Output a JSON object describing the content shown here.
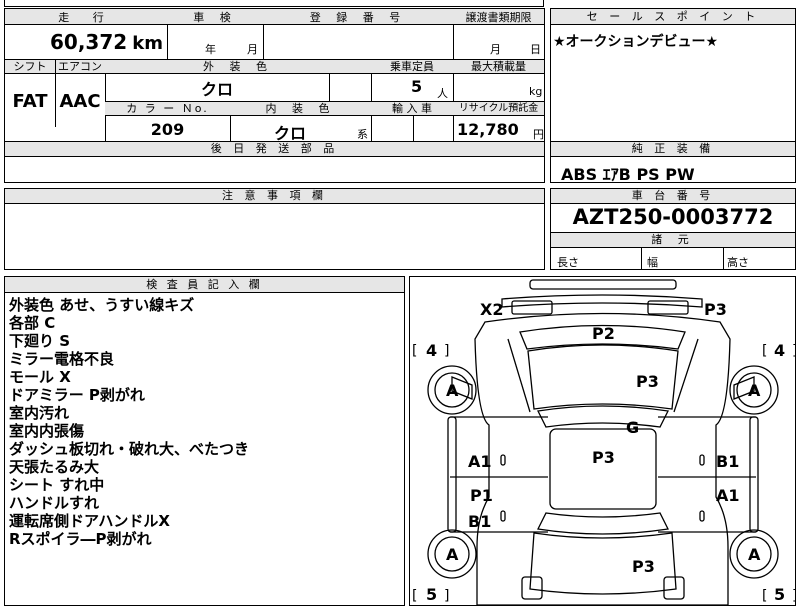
{
  "top_strip": {
    "cut_text": "..."
  },
  "mileage": {
    "label": "走 行",
    "value": "60,372",
    "unit": "km"
  },
  "inspection": {
    "label": "車 検",
    "year_unit": "年",
    "month_unit": "月"
  },
  "registration": {
    "label": "登 録 番 号"
  },
  "transfer_deadline": {
    "label": "譲渡書類期限",
    "month_unit": "月",
    "day_unit": "日"
  },
  "shift": {
    "label": "シフト",
    "value": "FAT"
  },
  "aircon": {
    "label": "エアコン",
    "value": "AAC"
  },
  "exterior_color": {
    "label": "外 装 色",
    "value": "クロ"
  },
  "capacity": {
    "label": "乗車定員",
    "value": "5",
    "unit": "人"
  },
  "max_load": {
    "label": "最大積載量",
    "unit": "kg"
  },
  "color_no": {
    "label": "カ ラ ー Ｎo.",
    "value": "209"
  },
  "interior_color": {
    "label": "内 装 色",
    "value": "クロ",
    "suffix": "系"
  },
  "import": {
    "label": "輸 入 車"
  },
  "recycle": {
    "label": "リサイクル預託金",
    "value": "12,780",
    "unit": "円"
  },
  "later_parts": {
    "label": "後 日 発 送 部 品"
  },
  "notes": {
    "label": "注 意 事 項 欄"
  },
  "sales_point": {
    "label": "セ ー ル ス ポ イ ン ト",
    "text": "★オークションデビュー★"
  },
  "genuine_equipment": {
    "label": "純 正 装 備",
    "value": "ABS ｴｱB PS PW"
  },
  "chassis": {
    "label": "車 台 番 号",
    "value": "AZT250-0003772"
  },
  "dimensions": {
    "label": "諸 元",
    "length": "長さ",
    "width": "幅",
    "height": "高さ"
  },
  "inspector": {
    "label": "検 査 員 記 入 欄",
    "remarks": [
      "外装色 あせ、うすい線キズ",
      "各部 C",
      "下廻り S",
      "ミラー電格不良",
      "モール X",
      "ドアミラー P剥がれ",
      "室内汚れ",
      "室内内張傷",
      "ダッシュ板切れ・破れ大、べたつき",
      "天張たるみ大",
      "シート すれ中",
      "ハンドルすれ",
      "運転席側ドアハンドルX",
      "Rスポイラ―P剥がれ"
    ]
  },
  "diagram": {
    "marks": {
      "x2": "X2",
      "p3_tr": "P3",
      "p2": "P2",
      "p3_hood": "P3",
      "g": "G",
      "p3_roof": "P3",
      "a1_left": "A1",
      "b1_right": "B1",
      "p1": "P1",
      "a1_right": "A1",
      "b1_left": "B1",
      "p3_trunk": "P3",
      "tire_fl": "A",
      "tire_fr": "A",
      "tire_rl": "A",
      "tire_rr": "A"
    },
    "tread": {
      "fl": "4",
      "fr": "4",
      "rl": "5",
      "rr": "5"
    }
  }
}
